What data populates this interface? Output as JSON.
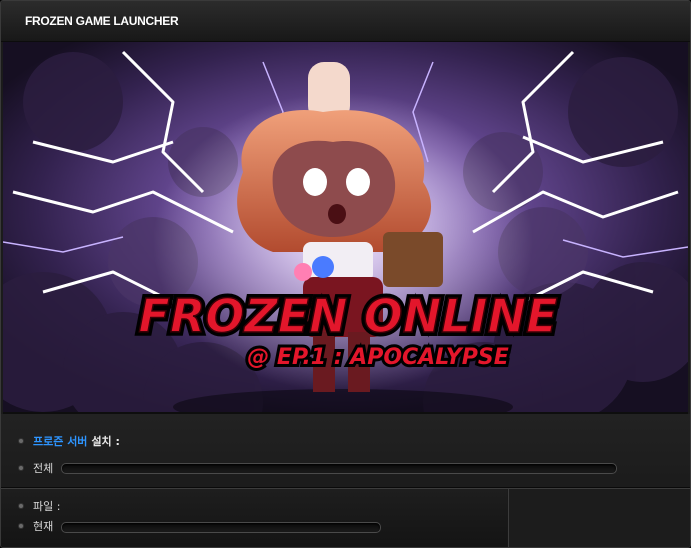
{
  "window": {
    "title": "FROZEN GAME LAUNCHER"
  },
  "banner": {
    "game_title": "FROZEN ONLINE",
    "subtitle": "@ EP.1 : APOCALYPSE"
  },
  "install": {
    "server_name": "프로즌 서버",
    "install_label": "설치 :",
    "total_label": "전체",
    "total_progress": 0
  },
  "download": {
    "file_label": "파일 :",
    "current_label": "현재",
    "current_progress": 0
  },
  "colors": {
    "accent": "#2e95ff",
    "title_red": "#e3162b",
    "background": "#1b1b1b"
  }
}
